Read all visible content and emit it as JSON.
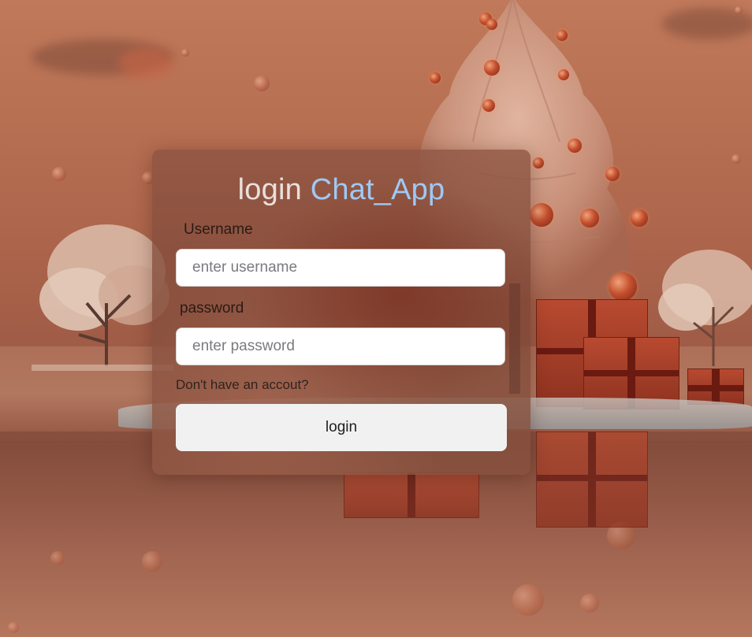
{
  "login": {
    "title_prefix": "login",
    "title_accent": "Chat_App",
    "username_label": "Username",
    "username_placeholder": "enter username",
    "password_label": "password",
    "password_placeholder": "enter password",
    "signup_link": "Don't have an accout?",
    "submit_label": "login"
  },
  "colors": {
    "title_accent": "#9ec9f5",
    "button_bg": "#f2f1f1",
    "background_tone": "#b0705a"
  }
}
